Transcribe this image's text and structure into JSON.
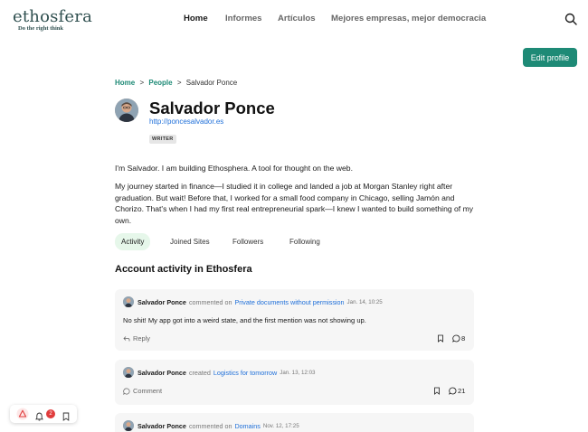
{
  "brand": {
    "name": "ethosfera",
    "tagline": "Do the right think"
  },
  "nav": {
    "items": [
      {
        "label": "Home"
      },
      {
        "label": "Informes"
      },
      {
        "label": "Artículos"
      },
      {
        "label": "Mejores empresas, mejor democracia"
      }
    ]
  },
  "actions": {
    "edit_profile": "Edit profile"
  },
  "breadcrumb": {
    "home": "Home",
    "sep1": ">",
    "people": "People",
    "sep2": ">",
    "current": "Salvador Ponce"
  },
  "profile": {
    "name": "Salvador Ponce",
    "website": "http://poncesalvador.es",
    "role": "WRITER",
    "bio": [
      "I'm Salvador. I am building Ethosphera. A tool for thought on the web.",
      "My journey started in finance—I studied it in college and landed a job at Morgan Stanley right after graduation. But wait! Before that, I worked for a small food company in Chicago, selling Jamón and Chorizo. That's when I had my first real entrepreneurial spark—I knew I wanted to build something of my own."
    ]
  },
  "tabs": [
    {
      "label": "Activity"
    },
    {
      "label": "Joined Sites"
    },
    {
      "label": "Followers"
    },
    {
      "label": "Following"
    }
  ],
  "activity": {
    "title": "Account activity in Ethosfera",
    "items": [
      {
        "author": "Salvador Ponce",
        "verb": "commented on",
        "target": "Private documents without permission",
        "date": "Jan. 14, 10:25",
        "body": "No shit! My app got into a weird state, and the first mention was not showing up.",
        "action": "Reply",
        "count": "8"
      },
      {
        "author": "Salvador Ponce",
        "verb": "created",
        "target": "Logistics for tomorrow",
        "date": "Jan. 13, 12:03",
        "body": "",
        "action": "Comment",
        "count": "21"
      },
      {
        "author": "Salvador Ponce",
        "verb": "commented on",
        "target": "Domains",
        "date": "Nov. 12, 17:25",
        "body": "",
        "action": "",
        "count": ""
      }
    ]
  },
  "dock": {
    "notifications": "2"
  },
  "colors": {
    "accent": "#1e8a76",
    "link": "#1e6fd9",
    "badge_red": "#e03c3c"
  }
}
